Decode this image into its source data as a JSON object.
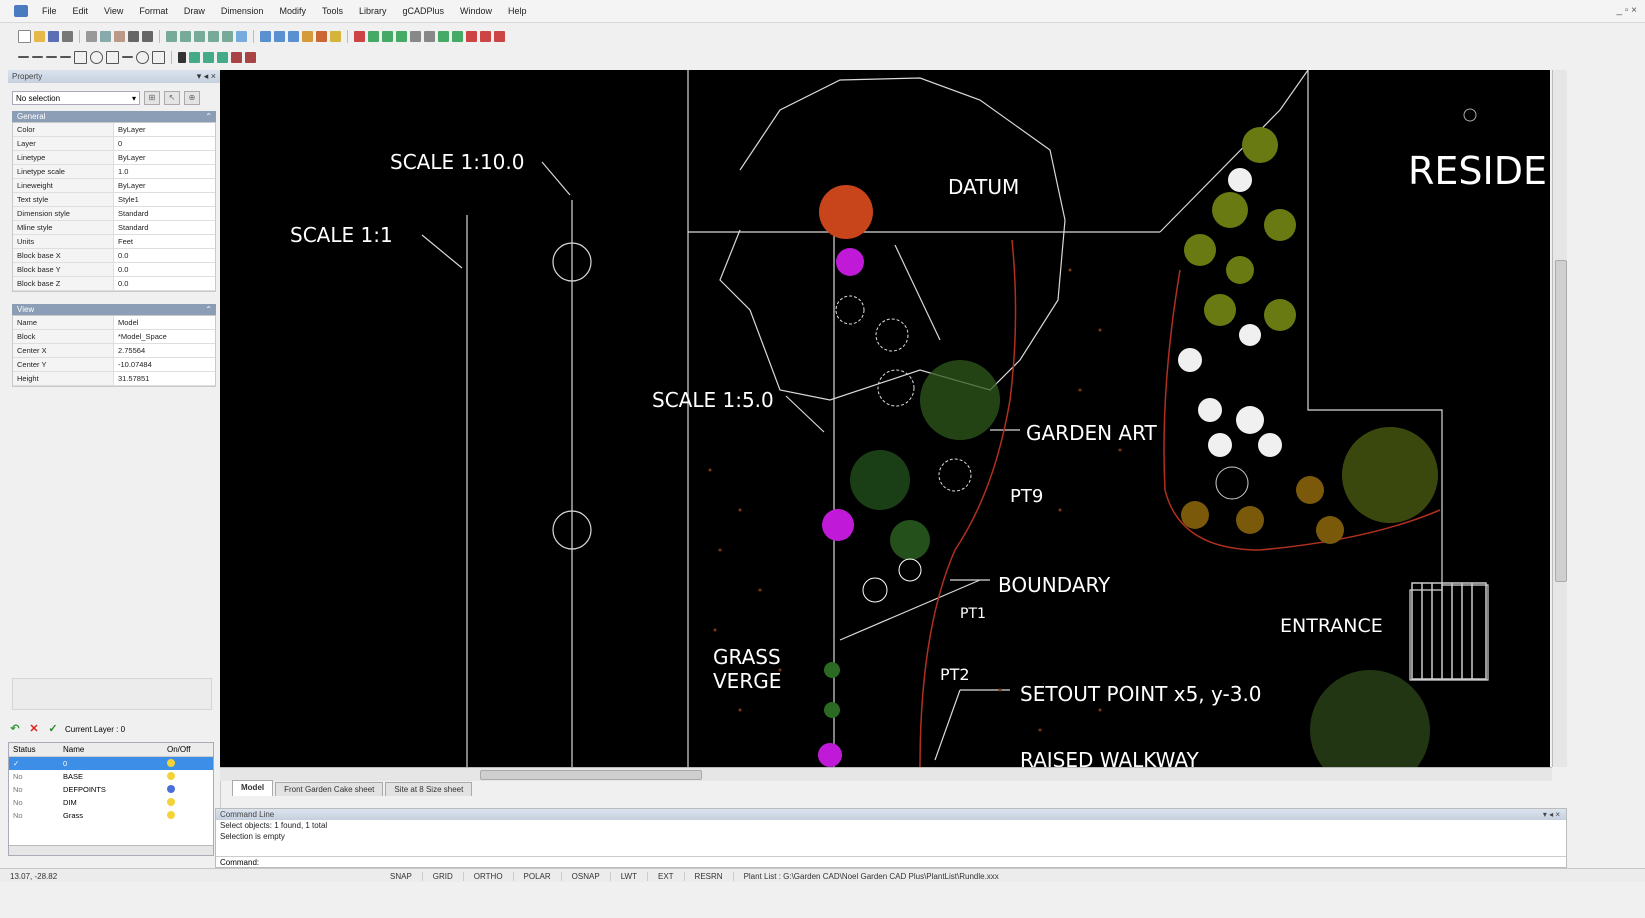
{
  "menu": [
    "File",
    "Edit",
    "View",
    "Format",
    "Draw",
    "Dimension",
    "Modify",
    "Tools",
    "Library",
    "gCADPlus",
    "Window",
    "Help"
  ],
  "property_panel": {
    "title": "Property",
    "selection": "No selection",
    "general": {
      "title": "General",
      "rows": [
        {
          "k": "Color",
          "v": "ByLayer"
        },
        {
          "k": "Layer",
          "v": "0"
        },
        {
          "k": "Linetype",
          "v": "ByLayer"
        },
        {
          "k": "Linetype scale",
          "v": "1.0"
        },
        {
          "k": "Lineweight",
          "v": "ByLayer"
        },
        {
          "k": "Text style",
          "v": "Style1"
        },
        {
          "k": "Dimension style",
          "v": "Standard"
        },
        {
          "k": "Mline style",
          "v": "Standard"
        },
        {
          "k": "Units",
          "v": "Feet"
        },
        {
          "k": "Block base X",
          "v": "0.0"
        },
        {
          "k": "Block base Y",
          "v": "0.0"
        },
        {
          "k": "Block base Z",
          "v": "0.0"
        }
      ]
    },
    "view": {
      "title": "View",
      "rows": [
        {
          "k": "Name",
          "v": "Model"
        },
        {
          "k": "Block",
          "v": "*Model_Space"
        },
        {
          "k": "Center X",
          "v": "2.75564"
        },
        {
          "k": "Center Y",
          "v": "-10.07484"
        },
        {
          "k": "Height",
          "v": "31.57851"
        }
      ]
    }
  },
  "layers": {
    "current": "Current Layer : 0",
    "headers": {
      "status": "Status",
      "name": "Name",
      "onoff": "On/Off"
    },
    "rows": [
      {
        "status": "✓",
        "name": "0",
        "selected": true
      },
      {
        "status": "No",
        "name": "BASE",
        "selected": false
      },
      {
        "status": "No",
        "name": "DEFPOINTS",
        "selected": false
      },
      {
        "status": "No",
        "name": "DIM",
        "selected": false
      },
      {
        "status": "No",
        "name": "Grass",
        "selected": false
      }
    ]
  },
  "drawing": {
    "labels": {
      "scale_1": "SCALE 1:1",
      "scale_10": "SCALE 1:10.0",
      "scale_5": "SCALE 1:5.0",
      "datum": "DATUM",
      "garden_art": "GARDEN ART",
      "pt9": "PT9",
      "boundary": "BOUNDARY",
      "pt1": "PT1",
      "pt2": "PT2",
      "grass": "GRASS",
      "verge": "VERGE",
      "setout": "SETOUT POINT x5, y-3.0",
      "entrance": "ENTRANCE",
      "raised": "RAISED WALKWAY",
      "reside": "RESIDE"
    }
  },
  "tabs": [
    "Model",
    "Front Garden Cake sheet",
    "Site at 8 Size sheet"
  ],
  "command": {
    "title": "Command Line",
    "lines": [
      "Select objects: 1 found, 1 total",
      "Selection is empty"
    ],
    "prompt": "Command:"
  },
  "status_bar": {
    "coords": "13.07, -28.82",
    "toggles": [
      "SNAP",
      "GRID",
      "ORTHO",
      "POLAR",
      "OSNAP",
      "LWT",
      "EXT",
      "RESRN"
    ],
    "path": "Plant List : G:\\Garden CAD\\Noel Garden CAD Plus\\PlantList\\Rundle.xxx"
  },
  "colors": {
    "canvas": "#000000",
    "accent": "#3d8ee6",
    "datum_fill": "#c8441a",
    "flower_magenta": "#c01ad8",
    "header_blue": "#8c9db6"
  }
}
